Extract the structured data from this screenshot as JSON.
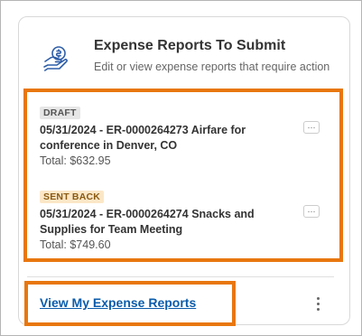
{
  "card": {
    "title": "Expense Reports To Submit",
    "subtitle": "Edit or view expense reports that require action",
    "icon": "expense-hand-icon"
  },
  "items": [
    {
      "status": "DRAFT",
      "title": "05/31/2024 - ER-0000264273 Airfare for conference in Denver, CO",
      "total": "Total: $632.95",
      "menu": "···"
    },
    {
      "status": "SENT BACK",
      "title": "05/31/2024 - ER-0000264274 Snacks and Supplies for Team Meeting",
      "total": "Total: $749.60",
      "menu": "···"
    }
  ],
  "footer": {
    "link_label": "View My Expense Reports"
  },
  "colors": {
    "highlight": "#e8770e",
    "link": "#0b5cab",
    "draft_badge_bg": "#e6e6e6",
    "sentback_badge_bg": "#fbe7c7",
    "icon_blue": "#2e5ea8"
  }
}
